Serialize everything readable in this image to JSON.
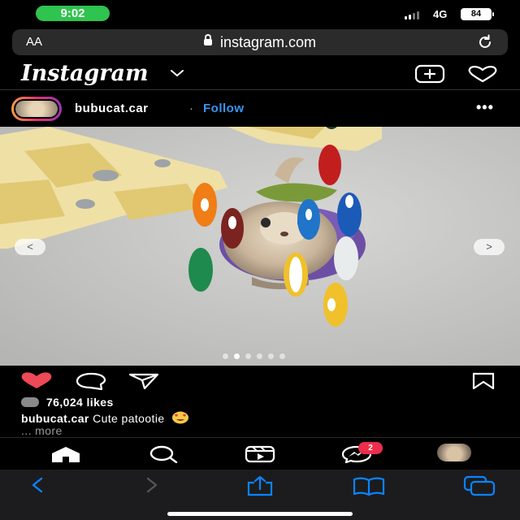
{
  "status_bar": {
    "time": "9:02",
    "network": "4G",
    "battery": "84"
  },
  "browser": {
    "text_size_label": "AA",
    "url": "instagram.com"
  },
  "instagram": {
    "logo": "Instagram",
    "post": {
      "username": "bubucat.car",
      "separator": "·",
      "follow_label": "Follow",
      "more_label": "•••",
      "carousel_prev": "<",
      "carousel_next": ">",
      "carousel_count": 6,
      "carousel_active": 2,
      "likes": "76,024 likes",
      "caption_user": "bubucat.car",
      "caption_text": "Cute patootie",
      "more_link": "... more"
    },
    "nav": {
      "messages_badge": "2"
    }
  },
  "icons": [
    "chevron-down-icon",
    "new-post-icon",
    "heart-icon",
    "more-icon",
    "like-heart-icon",
    "comment-icon",
    "share-icon",
    "save-icon",
    "home-icon",
    "search-icon",
    "reels-icon",
    "messenger-icon",
    "back-icon",
    "forward-icon",
    "share-sheet-icon",
    "bookmarks-icon",
    "tabs-icon",
    "lock-icon",
    "reload-icon"
  ],
  "colors": {
    "status_pill": "#2fc34f",
    "link_blue": "#3897f0",
    "like_red": "#ed4956",
    "badge_red": "#ed2d4c",
    "safari_blue": "#0a84ff"
  }
}
